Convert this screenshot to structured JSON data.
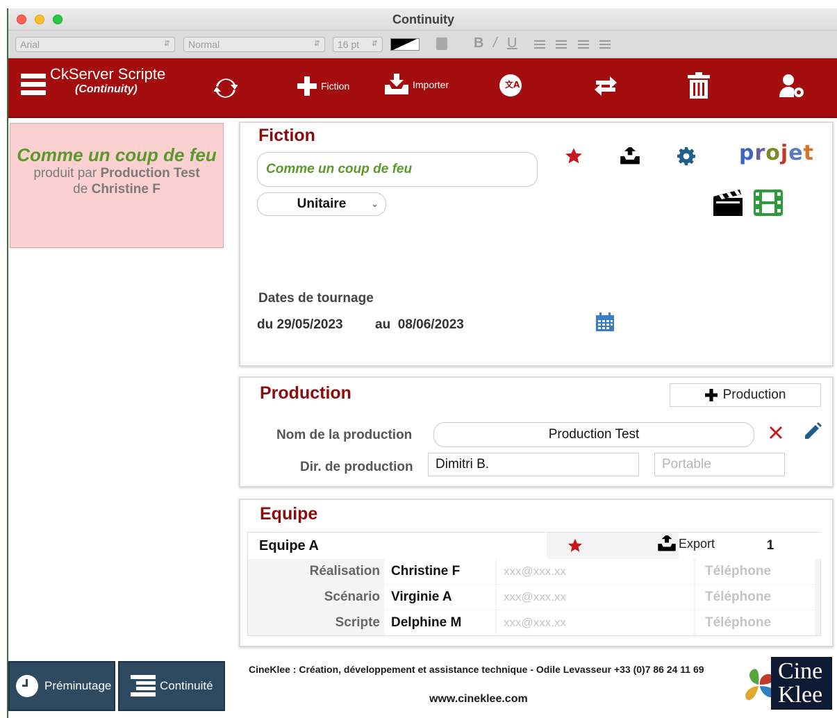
{
  "window": {
    "title": "Continuity"
  },
  "format_toolbar": {
    "font": "Arial",
    "style": "Normal",
    "size": "16 pt",
    "bold": "B",
    "italic": "/",
    "underline": "U"
  },
  "header": {
    "app_title": "CkServer Scripte",
    "app_subtitle": "(Continuity)",
    "fiction_label": "Fiction",
    "import_label": "Importer",
    "colors": {
      "brand_red": "#a30d0d"
    }
  },
  "left_card": {
    "title": "Comme un coup de feu",
    "produced_by_prefix": "produit par",
    "producer": "Production Test",
    "author_prefix": "de",
    "author": "Christine F"
  },
  "fiction": {
    "heading": "Fiction",
    "title_value": "Comme un coup de feu",
    "type_value": "Unitaire",
    "projet_label": "projet",
    "dates_label": "Dates de tournage",
    "from_prefix": "du",
    "from_date": "29/05/2023",
    "to_prefix": "au",
    "to_date": "08/06/2023"
  },
  "production": {
    "heading": "Production",
    "add_button": "Production",
    "name_label": "Nom de la production",
    "name_value": "Production Test",
    "director_label": "Dir. de production",
    "director_value": "Dimitri B.",
    "mobile_placeholder": "Portable"
  },
  "equipe": {
    "heading": "Equipe",
    "team_name": "Equipe A",
    "export_label": "Export",
    "team_number": "1",
    "members": [
      {
        "role": "Réalisation",
        "name": "Christine F",
        "email_placeholder": "xxx@xxx.xx",
        "phone_placeholder": "Téléphone"
      },
      {
        "role": "Scénario",
        "name": "Virginie A",
        "email_placeholder": "xxx@xxx.xx",
        "phone_placeholder": "Téléphone"
      },
      {
        "role": "Scripte",
        "name": "Delphine M",
        "email_placeholder": "xxx@xxx.xx",
        "phone_placeholder": "Téléphone"
      }
    ]
  },
  "bottom_nav": {
    "preminutage": "Préminutage",
    "continuite": "Continuité"
  },
  "footer": {
    "credits": "CineKlee : Création, développement et assistance technique - Odile Levasseur +33 (0)7 86 24 11 69",
    "website": "www.cineklee.com",
    "logo_line1": "Cine",
    "logo_line2": "Klee"
  }
}
